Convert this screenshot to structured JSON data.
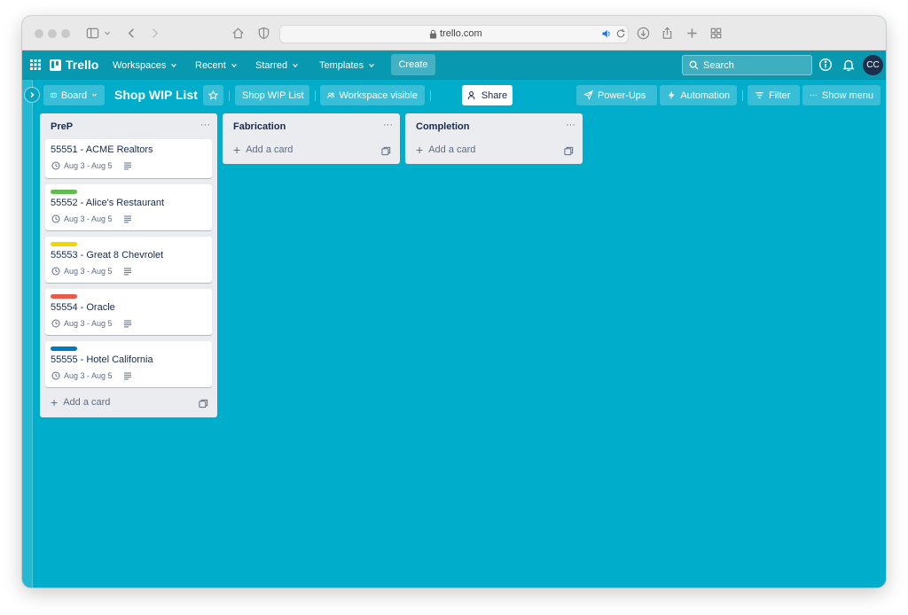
{
  "browser": {
    "url": "trello.com"
  },
  "header": {
    "logo_text": "Trello",
    "nav": [
      "Workspaces",
      "Recent",
      "Starred",
      "Templates"
    ],
    "create_label": "Create",
    "search_placeholder": "Search",
    "avatar_initials": "CC"
  },
  "boardbar": {
    "view_label": "Board",
    "board_title": "Shop WIP List",
    "workspace_name": "Shop WIP List",
    "visibility_label": "Workspace visible",
    "share_label": "Share",
    "powerups_label": "Power-Ups",
    "automation_label": "Automation",
    "filter_label": "Filter",
    "show_menu_label": "Show menu"
  },
  "lists": [
    {
      "title": "PreP",
      "menu": "···",
      "add_card_label": "Add a card",
      "cards": [
        {
          "title": "55551 - ACME Realtors",
          "dates": "Aug 3 - Aug 5",
          "label_color": null
        },
        {
          "title": "55552 - Alice's Restaurant",
          "dates": "Aug 3 - Aug 5",
          "label_color": "#61bd4f"
        },
        {
          "title": "55553 - Great 8 Chevrolet",
          "dates": "Aug 3 - Aug 5",
          "label_color": "#f2d600"
        },
        {
          "title": "55554 - Oracle",
          "dates": "Aug 3 - Aug 5",
          "label_color": "#eb5a46"
        },
        {
          "title": "55555 - Hotel California",
          "dates": "Aug 3 - Aug 5",
          "label_color": "#0079bf"
        }
      ]
    },
    {
      "title": "Fabrication",
      "menu": "···",
      "add_card_label": "Add a card",
      "cards": []
    },
    {
      "title": "Completion",
      "menu": "···",
      "add_card_label": "Add a card",
      "cards": []
    }
  ],
  "colors": {
    "board_background": "#00aecc",
    "header_background": "#0898b0",
    "list_background": "#ebecf0"
  }
}
